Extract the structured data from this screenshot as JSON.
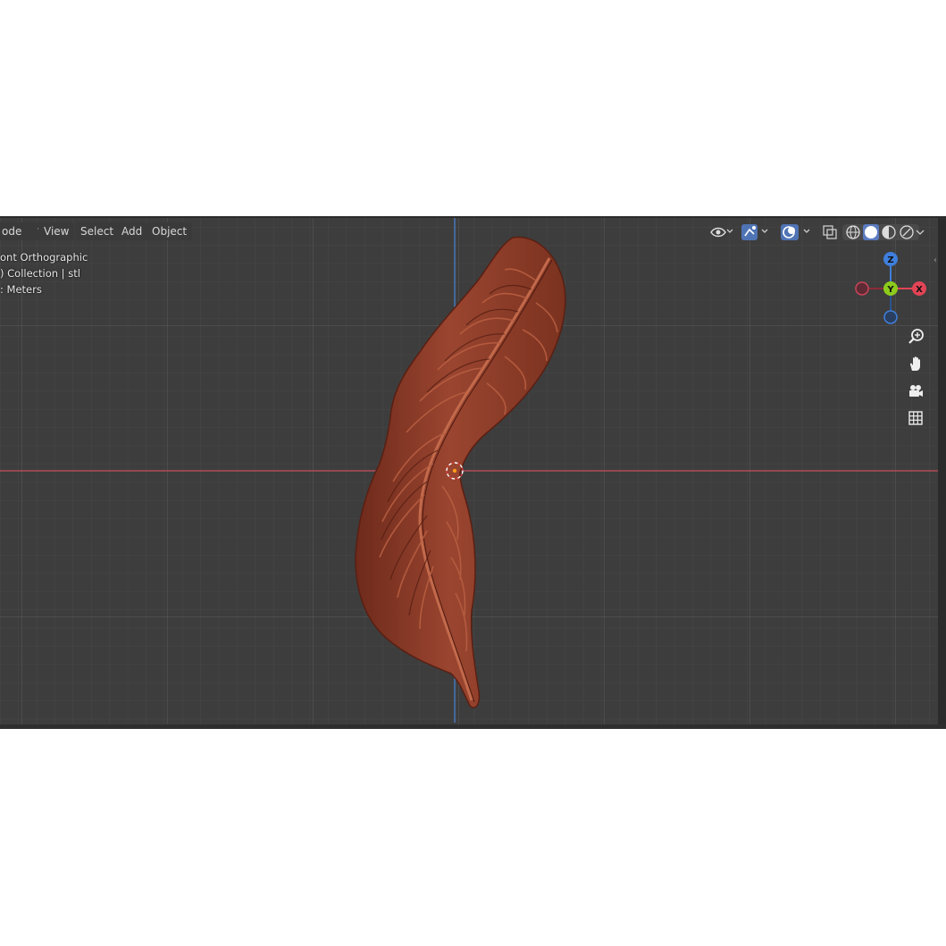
{
  "header": {
    "mode_label": "ode",
    "menu": [
      "View",
      "Select",
      "Add",
      "Object"
    ]
  },
  "overlay": {
    "view_name": "ont Orthographic",
    "collection": ") Collection | stl",
    "units": ": Meters"
  },
  "gizmo": {
    "z_label": "Z",
    "y_label": "Y",
    "x_label": "X",
    "colors": {
      "x": "#e24456",
      "y": "#8ccb1c",
      "z": "#3f7fdc",
      "neg_x": "#8c2b39",
      "neg_z": "#2b5390"
    }
  },
  "axis_colors": {
    "x_line": "#c64b5a",
    "z_line": "#4a86d6"
  },
  "object_color": "#8a3a26",
  "icons": [
    "visibility-icon",
    "gizmo-toggle-icon",
    "overlay-icon",
    "xray-icon",
    "wireframe-shading-icon",
    "solid-shading-icon",
    "material-shading-icon",
    "rendered-shading-icon",
    "zoom-icon",
    "pan-hand-icon",
    "camera-icon",
    "grid-view-icon",
    "3d-cursor-icon"
  ]
}
